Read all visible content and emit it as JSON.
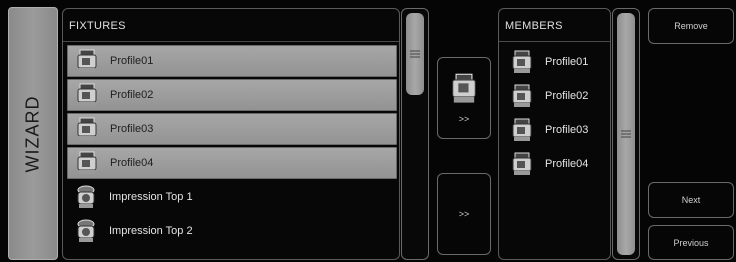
{
  "wizard": {
    "label": "WIZARD"
  },
  "fixtures": {
    "title": "FIXTURES",
    "items": [
      {
        "label": "Profile01",
        "selected": true
      },
      {
        "label": "Profile02",
        "selected": true
      },
      {
        "label": "Profile03",
        "selected": true
      },
      {
        "label": "Profile04",
        "selected": true
      },
      {
        "label": "Impression Top 1",
        "selected": false
      },
      {
        "label": "Impression Top 2",
        "selected": false
      }
    ]
  },
  "transfer": {
    "add_selected_label": ">>",
    "add_all_label": ">>"
  },
  "members": {
    "title": "MEMBERS",
    "items": [
      {
        "label": "Profile01"
      },
      {
        "label": "Profile02"
      },
      {
        "label": "Profile03"
      },
      {
        "label": "Profile04"
      }
    ]
  },
  "actions": {
    "remove_label": "Remove",
    "next_label": "Next",
    "previous_label": "Previous"
  }
}
